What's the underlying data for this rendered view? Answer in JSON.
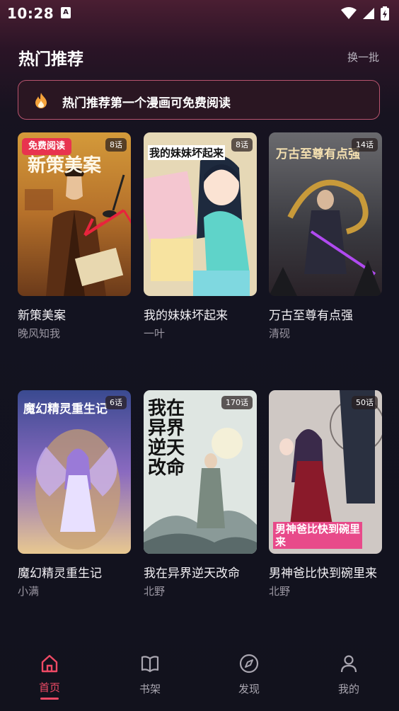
{
  "status_bar": {
    "time": "10:28",
    "notification_glyph": "A"
  },
  "header": {
    "title": "热门推荐",
    "refresh_label": "换一批"
  },
  "banner": {
    "icon": "flame-icon",
    "text": "热门推荐第一个漫画可免费阅读"
  },
  "comics": [
    {
      "title": "新策美案",
      "author": "晚风知我",
      "episodes": "8话",
      "badge": "免费阅读",
      "cover_text": "新策美案"
    },
    {
      "title": "我的妹妹坏起来",
      "author": "一叶",
      "episodes": "8话",
      "cover_text": "我的妹妹坏起来"
    },
    {
      "title": "万古至尊有点强",
      "author": "清砚",
      "episodes": "14话",
      "cover_text": "万古至尊有点强"
    },
    {
      "title": "魔幻精灵重生记",
      "author": "小满",
      "episodes": "6话",
      "cover_text": "魔幻精灵重生记"
    },
    {
      "title": "我在异界逆天改命",
      "author": "北野",
      "episodes": "170话",
      "cover_text": "我在异界逆天改命"
    },
    {
      "title": "男神爸比快到碗里来",
      "author": "北野",
      "episodes": "50话",
      "cover_text": "男神爸比快到碗里来"
    }
  ],
  "tabs": [
    {
      "label": "首页",
      "icon": "home-icon",
      "active": true
    },
    {
      "label": "书架",
      "icon": "book-icon",
      "active": false
    },
    {
      "label": "发现",
      "icon": "compass-icon",
      "active": false
    },
    {
      "label": "我的",
      "icon": "user-icon",
      "active": false
    }
  ],
  "colors": {
    "accent": "#ef4a65",
    "banner_border": "#b8546e",
    "free_badge": "#e8334f"
  }
}
